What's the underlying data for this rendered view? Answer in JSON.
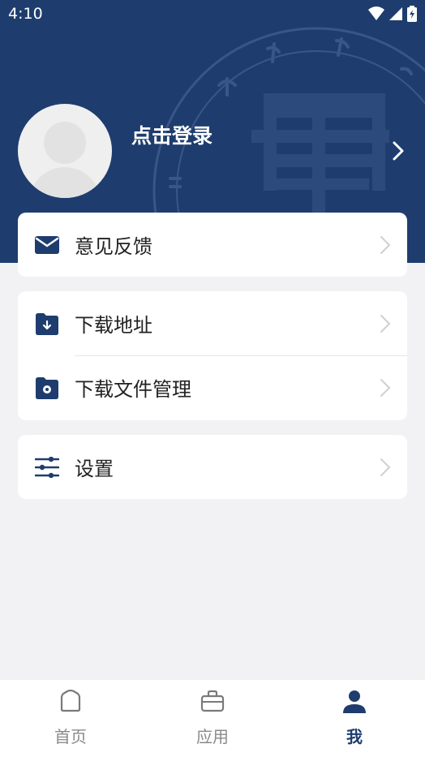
{
  "status_bar": {
    "time": "4:10"
  },
  "profile": {
    "login_label": "点击登录"
  },
  "menu": {
    "feedback": "意见反馈",
    "download_address": "下载地址",
    "download_files": "下载文件管理",
    "settings": "设置"
  },
  "tabs": [
    {
      "label": "首页",
      "icon": "home-icon"
    },
    {
      "label": "应用",
      "icon": "briefcase-icon"
    },
    {
      "label": "我",
      "icon": "user-icon"
    }
  ],
  "colors": {
    "brand": "#1e3d6e",
    "background": "#f2f2f4"
  }
}
